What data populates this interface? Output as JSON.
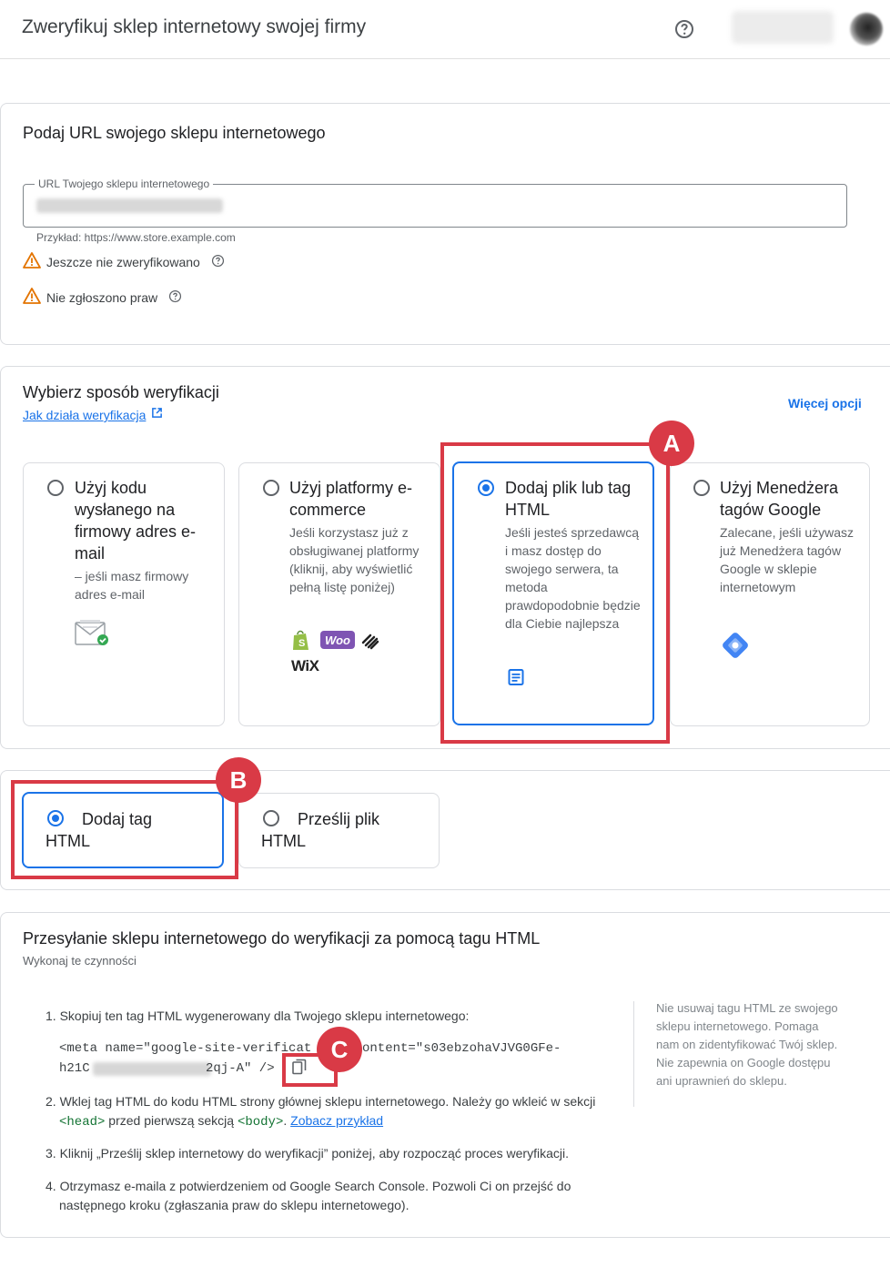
{
  "header": {
    "title": "Zweryfikuj sklep internetowy swojej firmy",
    "help_icon": "help-circle-icon"
  },
  "url_section": {
    "title": "Podaj URL swojego sklepu internetowego",
    "field_label": "URL Twojego sklepu internetowego",
    "helper": "Przykład: https://www.store.example.com",
    "status_verify": "Jeszcze nie zweryfikowano",
    "status_claim": "Nie zgłoszono praw",
    "warning_color": "#e37400"
  },
  "method_section": {
    "title": "Wybierz sposób weryfikacji",
    "how_link": "Jak działa weryfikacja",
    "more_options": "Więcej opcji",
    "options": [
      {
        "title": "Użyj kodu wysłanego na firmowy adres e-mail",
        "desc": "– jeśli masz firmowy adres e-mail",
        "selected": false
      },
      {
        "title": "Użyj platformy e-commerce",
        "desc": "Jeśli korzystasz już z obsługiwanej platformy (kliknij, aby wyświetlić pełną listę poniżej)",
        "selected": false
      },
      {
        "title": "Dodaj plik lub tag HTML",
        "desc": "Jeśli jesteś sprzedawcą i masz dostęp do swojego serwera, ta metoda prawdopodobnie będzie dla Ciebie najlepsza",
        "selected": true
      },
      {
        "title": "Użyj Menedżera tagów Google",
        "desc": "Zalecane, jeśli używasz już Menedżera tagów Google w sklepie internetowym",
        "selected": false
      }
    ],
    "platform_logos": [
      "Woo",
      "WiX"
    ]
  },
  "submethod": {
    "options": [
      {
        "title": "Dodaj tag HTML",
        "selected": true
      },
      {
        "title": "Prześlij plik HTML",
        "selected": false
      }
    ]
  },
  "instructions": {
    "title": "Przesyłanie sklepu internetowego do weryfikacji za pomocą tagu HTML",
    "subtitle": "Wykonaj te czynności",
    "step1": "1. Skopiuj ten tag HTML wygenerowany dla Twojego sklepu internetowego:",
    "code_line1_a": "<meta name=\"google-site-verificat",
    "code_line1_b": "ontent=\"s03ebzohaVJVG0GFe-",
    "code_line2_a": "h21C",
    "code_line2_b": "2qj-A\" />",
    "step2_a": "2. Wklej tag HTML do kodu HTML strony głównej sklepu internetowego. Należy go wkleić w sekcji",
    "step2_head": "<head>",
    "step2_mid": " przed pierwszą sekcją ",
    "step2_body": "<body>",
    "step2_dot": ". ",
    "step2_link": "Zobacz przykład",
    "step3": "3. Kliknij „Prześlij sklep internetowy do weryfikacji” poniżej, aby rozpocząć proces weryfikacji.",
    "step4_a": "4. Otrzymasz e-maila z potwierdzeniem od Google Search Console. Pozwoli Ci on przejść do",
    "step4_b": "następnego kroku (zgłaszania praw do sklepu internetowego).",
    "side_note": "Nie usuwaj tagu HTML ze swojego sklepu internetowego. Pomaga nam on zidentyfikować Twój sklep. Nie zapewnia on Google dostępu ani uprawnień do sklepu."
  },
  "annotations": {
    "a": "A",
    "b": "B",
    "c": "C",
    "color": "#d93a46"
  }
}
